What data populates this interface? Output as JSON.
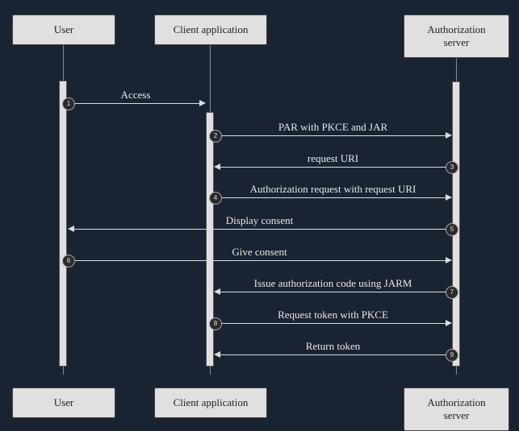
{
  "participants": {
    "user": "User",
    "client": "Client application",
    "auth": "Authorization server"
  },
  "messages": {
    "1": {
      "n": "1",
      "label": "Access"
    },
    "2": {
      "n": "2",
      "label": "PAR with PKCE and JAR"
    },
    "3": {
      "n": "3",
      "label": "request URI"
    },
    "4": {
      "n": "4",
      "label": "Authorization request with request URI"
    },
    "5": {
      "n": "5",
      "label": "Display consent"
    },
    "6": {
      "n": "6",
      "label": "Give consent"
    },
    "7": {
      "n": "7",
      "label": "Issue authorization code using JARM"
    },
    "8": {
      "n": "8",
      "label": "Request token with PKCE"
    },
    "9": {
      "n": "9",
      "label": "Return token"
    }
  }
}
